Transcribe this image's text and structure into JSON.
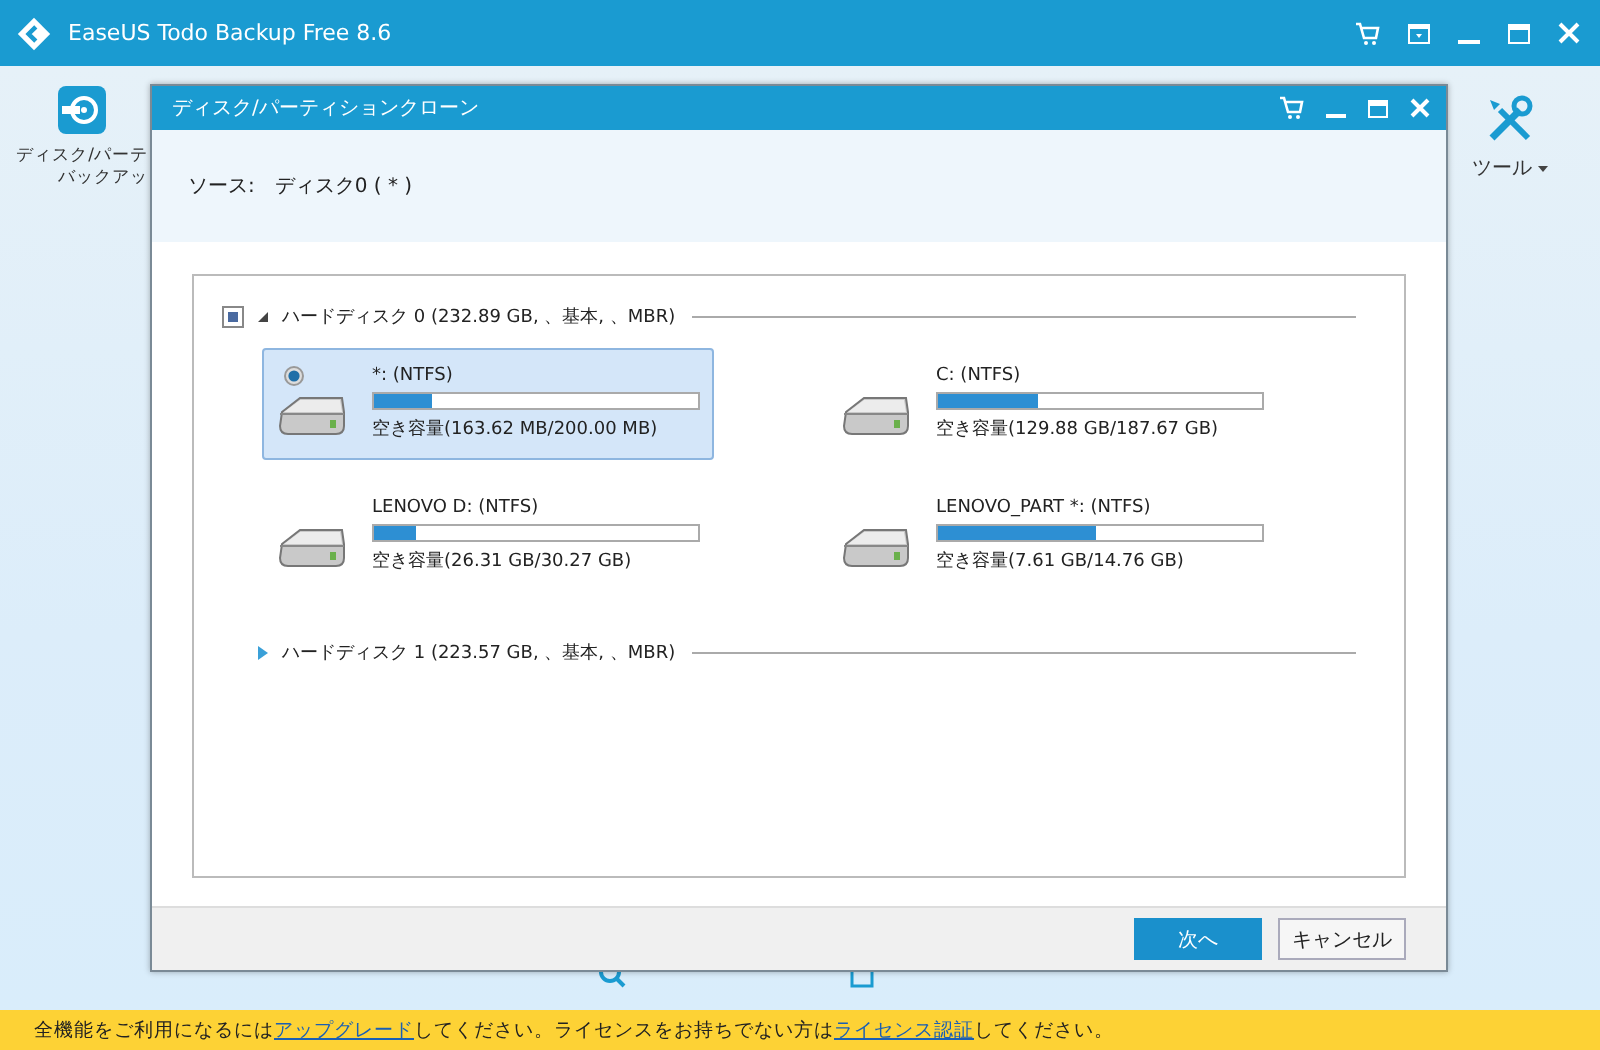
{
  "window": {
    "title": "EaseUS Todo Backup Free 8.6"
  },
  "background_tools": [
    {
      "label": "ディスク/パーテ",
      "label_2": "バックアッ"
    },
    {
      "label": "ツール"
    }
  ],
  "dialog": {
    "title": "ディスク/パーティションクローン",
    "source_label": "ソース:",
    "source_value": "ディスク0 ( * )",
    "disks": [
      {
        "label": "ハードディスク 0 (232.89 GB, 、基本, 、MBR)",
        "expanded": true,
        "checked": true,
        "partitions": [
          {
            "name": "*: (NTFS)",
            "level": 0.18,
            "free": "空き容量(163.62 MB/200.00 MB)",
            "selected": true
          },
          {
            "name": "C: (NTFS)",
            "level": 0.31,
            "free": "空き容量(129.88 GB/187.67 GB)",
            "selected": false
          },
          {
            "name": "LENOVO D: (NTFS)",
            "level": 0.13,
            "free": "空き容量(26.31 GB/30.27 GB)",
            "selected": false
          },
          {
            "name": "LENOVO_PART *: (NTFS)",
            "level": 0.49,
            "free": "空き容量(7.61 GB/14.76 GB)",
            "selected": false
          }
        ]
      },
      {
        "label": "ハードディスク 1 (223.57 GB, 、基本, 、MBR)",
        "expanded": false
      }
    ],
    "buttons": [
      {
        "label": "次へ",
        "primary": true
      },
      {
        "label": "キャンセル",
        "primary": false
      }
    ]
  },
  "notice": {
    "before": "全機能をご利用になるには",
    "link_1": "アップグレード",
    "middle": "してください。ライセンスをお持ちでない方は",
    "link_2": "ライセンス認証",
    "after": "してください。"
  }
}
